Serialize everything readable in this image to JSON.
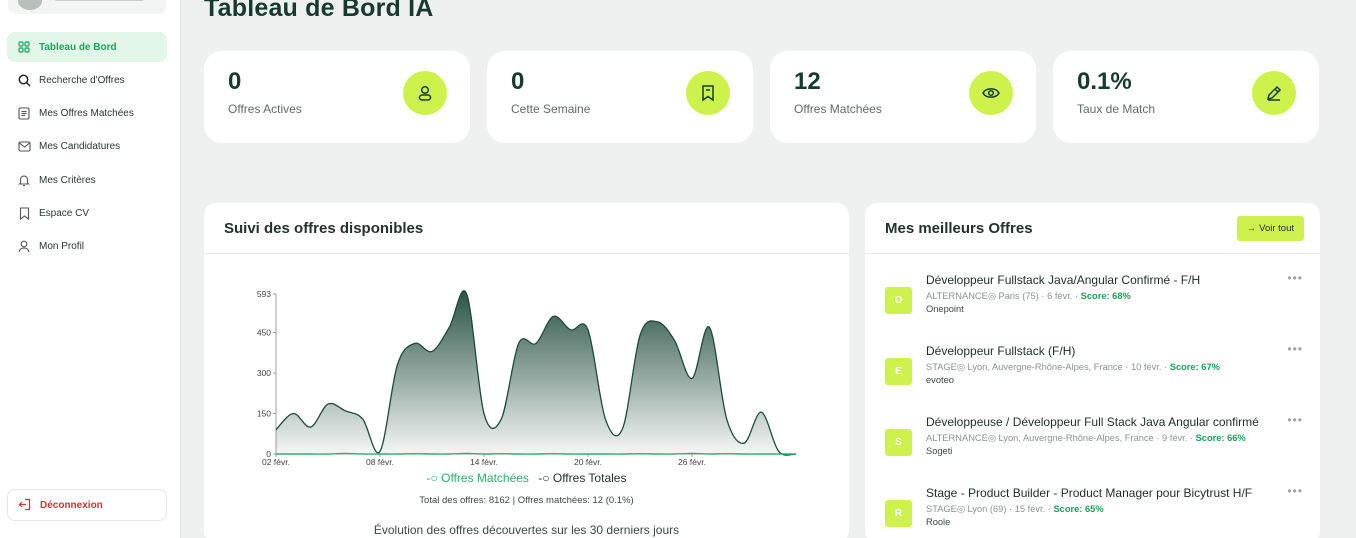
{
  "sidebar": {
    "items": [
      {
        "label": "Tableau de Bord",
        "icon": "dashboard-icon"
      },
      {
        "label": "Recherche d'Offres",
        "icon": "search-icon"
      },
      {
        "label": "Mes Offres Matchées",
        "icon": "list-icon"
      },
      {
        "label": "Mes Candidatures",
        "icon": "mail-icon"
      },
      {
        "label": "Mes Critères",
        "icon": "bell-icon"
      },
      {
        "label": "Espace CV",
        "icon": "bookmark-icon"
      },
      {
        "label": "Mon Profil",
        "icon": "user-icon"
      }
    ],
    "logout_label": "Déconnexion"
  },
  "page": {
    "title": "Tableau de Bord IA"
  },
  "stats": [
    {
      "value": "0",
      "label": "Offres Actives",
      "icon": "user-icon"
    },
    {
      "value": "0",
      "label": "Cette Semaine",
      "icon": "bookmark-icon"
    },
    {
      "value": "12",
      "label": "Offres Matchées",
      "icon": "eye-icon"
    },
    {
      "value": "0.1%",
      "label": "Taux de Match",
      "icon": "pencil-icon"
    }
  ],
  "chart_panel": {
    "title": "Suivi des offres disponibles",
    "legend": {
      "matched": "Offres Matchées",
      "total": "Offres Totales"
    },
    "totals_text": "Total des offres: 8162 | Offres matchées: 12 (0.1%)",
    "footer_text": "Évolution des offres découvertes sur les 30 derniers jours"
  },
  "chart_data": {
    "type": "area",
    "title": "",
    "xlabel": "",
    "ylabel": "",
    "yticks": [
      "0",
      "150",
      "300",
      "450",
      "593"
    ],
    "xticks": [
      "02 févr.",
      "08 févr.",
      "14 févr.",
      "20 févr.",
      "26 févr."
    ],
    "ylim": [
      0,
      593
    ],
    "x": [
      0,
      1,
      2,
      3,
      4,
      5,
      6,
      7,
      8,
      9,
      10,
      11,
      12,
      13,
      14,
      15,
      16,
      17,
      18,
      19,
      20,
      21,
      22,
      23,
      24,
      25,
      26,
      27,
      28,
      29,
      30
    ],
    "series": [
      {
        "name": "Offres Totales",
        "color": "#1e4a3c",
        "values": [
          90,
          150,
          100,
          185,
          160,
          130,
          10,
          330,
          410,
          380,
          470,
          593,
          150,
          130,
          410,
          410,
          510,
          460,
          460,
          130,
          95,
          440,
          490,
          420,
          280,
          470,
          130,
          40,
          155,
          10,
          0
        ]
      },
      {
        "name": "Offres Matchées",
        "color": "#2eaf6c",
        "values": [
          0,
          0,
          0,
          0,
          2,
          0,
          0,
          0,
          1,
          0,
          0,
          2,
          0,
          1,
          0,
          0,
          1,
          0,
          0,
          0,
          0,
          1,
          0,
          0,
          2,
          0,
          1,
          0,
          0,
          0,
          0
        ]
      }
    ],
    "grid": false,
    "legend_position": "bottom"
  },
  "offers_panel": {
    "title": "Mes meilleurs Offres",
    "see_all_label": "Voir tout",
    "offers": [
      {
        "badge": "O",
        "title": "Développeur Fullstack Java/Angular Confirmé - F/H",
        "meta": "ALTERNANCE◎ Paris (75) · 6 févr. · ",
        "score": "Score: 68%",
        "company": "Onepoint"
      },
      {
        "badge": "E",
        "title": "Développeur Fullstack (F/H)",
        "meta": "STAGE◎ Lyon, Auvergne-Rhône-Alpes, France · 10 févr. · ",
        "score": "Score: 67%",
        "company": "evoteo"
      },
      {
        "badge": "S",
        "title": "Développeuse / Développeur Full Stack Java Angular confirmé",
        "meta": "ALTERNANCE◎ Lyon, Auvergne-Rhône-Alpes, France · 9 févr. · ",
        "score": "Score: 66%",
        "company": "Sogeti"
      },
      {
        "badge": "R",
        "title": "Stage - Product Builder - Product Manager pour Bicytrust H/F",
        "meta": "STAGE◎ Lyon (69) · 15 févr. · ",
        "score": "Score: 65%",
        "company": "Roole"
      }
    ]
  }
}
